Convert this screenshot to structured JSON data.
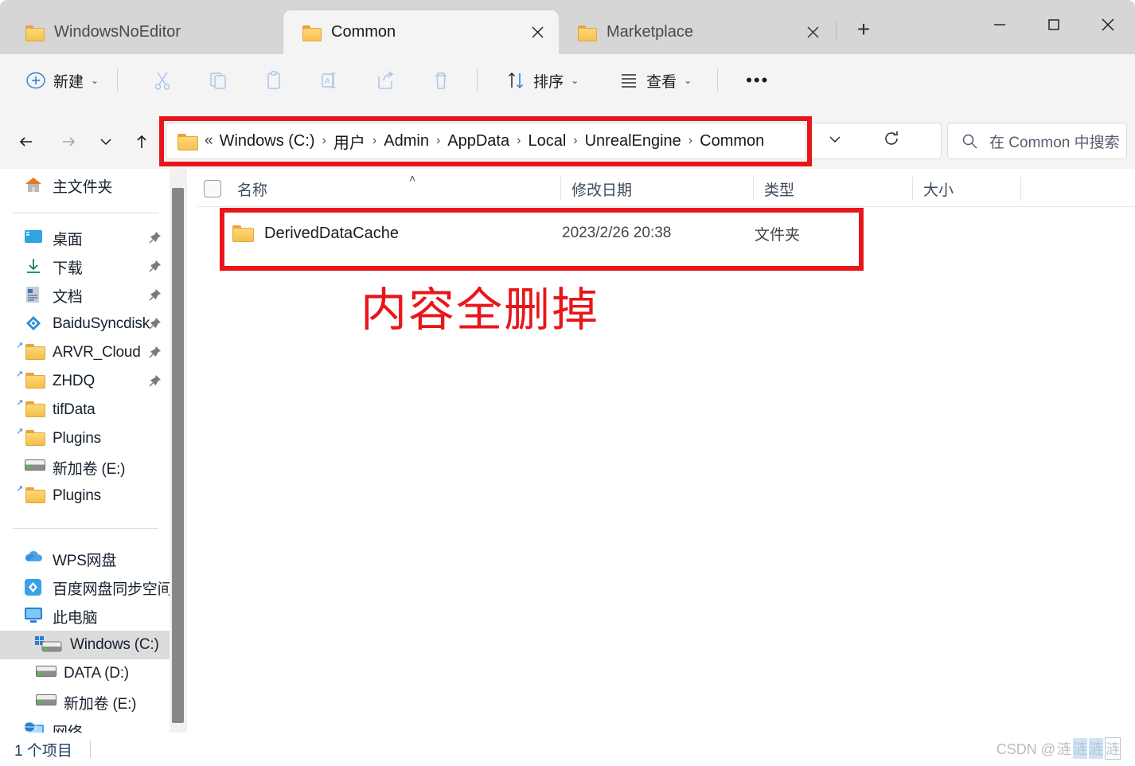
{
  "window": {
    "tabs": [
      {
        "label": "WindowsNoEditor",
        "active": false,
        "icon": "folder-icon",
        "close_icon": "close-icon"
      },
      {
        "label": "Common",
        "active": true,
        "icon": "folder-icon",
        "close_icon": "close-icon"
      },
      {
        "label": "Marketplace",
        "active": false,
        "icon": "folder-icon",
        "close_icon": "close-icon"
      }
    ],
    "new_tab_label": "+",
    "controls": {
      "minimize": "−",
      "maximize": "□",
      "close": "✕"
    }
  },
  "toolbar": {
    "new_label": "新建",
    "new_chevron": "⌄",
    "sort_label": "排序",
    "sort_chevron": "⌄",
    "view_label": "查看",
    "view_chevron": "⌄",
    "more_label": "•••",
    "icons": {
      "new": "plus-circle-icon",
      "cut": "scissors-icon",
      "copy": "copy-icon",
      "paste": "paste-icon",
      "rename": "rename-icon",
      "share": "share-icon",
      "delete": "trash-icon",
      "sort": "sort-arrows-icon",
      "view": "list-view-icon",
      "more": "more-ellipsis-icon"
    }
  },
  "nav": {
    "back": "←",
    "forward": "→",
    "recent": "⌄",
    "up": "↑",
    "refresh": "⟳",
    "dropdown": "⌄"
  },
  "address": {
    "folder_icon": "folder-icon",
    "lead": "«",
    "separator": "›",
    "crumbs": [
      "Windows (C:)",
      "用户",
      "Admin",
      "AppData",
      "Local",
      "UnrealEngine",
      "Common"
    ]
  },
  "search": {
    "icon": "search-icon",
    "placeholder": "在 Common 中搜索",
    "value": ""
  },
  "sidebar": {
    "home": {
      "label": "主文件夹",
      "icon": "home-icon"
    },
    "groups": [
      {
        "items": [
          {
            "label": "桌面",
            "icon": "desktop-icon",
            "pinned": true
          },
          {
            "label": "下载",
            "icon": "download-icon",
            "pinned": true
          },
          {
            "label": "文档",
            "icon": "document-icon",
            "pinned": true
          },
          {
            "label": "BaiduSyncdisk",
            "icon": "baidu-icon",
            "pinned": true
          },
          {
            "label": "ARVR_Cloud",
            "icon": "folder-shortcut-icon",
            "pinned": true
          },
          {
            "label": "ZHDQ",
            "icon": "folder-shortcut-icon",
            "pinned": true
          },
          {
            "label": "tifData",
            "icon": "folder-shortcut-icon",
            "pinned": false
          },
          {
            "label": "Plugins",
            "icon": "folder-shortcut-icon",
            "pinned": false
          },
          {
            "label": "新加卷 (E:)",
            "icon": "drive-icon",
            "pinned": false
          },
          {
            "label": "Plugins",
            "icon": "folder-shortcut-icon",
            "pinned": false
          }
        ]
      },
      {
        "items": [
          {
            "label": "WPS网盘",
            "icon": "wps-cloud-icon",
            "pinned": false
          },
          {
            "label": "百度网盘同步空间",
            "icon": "baidu-netdisk-icon",
            "pinned": false
          },
          {
            "label": "此电脑",
            "icon": "this-pc-icon",
            "pinned": false
          },
          {
            "label": "Windows (C:)",
            "icon": "windows-drive-icon",
            "pinned": false,
            "selected": true
          },
          {
            "label": "DATA (D:)",
            "icon": "drive-icon",
            "pinned": false
          },
          {
            "label": "新加卷 (E:)",
            "icon": "drive-icon",
            "pinned": false
          },
          {
            "label": "网络",
            "icon": "network-icon",
            "pinned": false
          }
        ]
      }
    ]
  },
  "file_list": {
    "select_all_checkbox": false,
    "sort_indicator": "˄",
    "columns": [
      {
        "key": "name",
        "label": "名称"
      },
      {
        "key": "date",
        "label": "修改日期"
      },
      {
        "key": "type",
        "label": "类型"
      },
      {
        "key": "size",
        "label": "大小"
      }
    ],
    "rows": [
      {
        "icon": "folder-icon",
        "name": "DerivedDataCache",
        "date": "2023/2/26 20:38",
        "type": "文件夹",
        "size": ""
      }
    ]
  },
  "annotations": {
    "note_text": "内容全删掉",
    "color": "#e8161a",
    "boxes": [
      "address-bar-highlight",
      "file-row-highlight"
    ]
  },
  "statusbar": {
    "item_count": "1 个项目"
  },
  "watermark": {
    "prefix": "CSDN @",
    "name_part1": "涟",
    "name_part2": "涟",
    "name_part3": "涟",
    "name_part4": "涟"
  }
}
